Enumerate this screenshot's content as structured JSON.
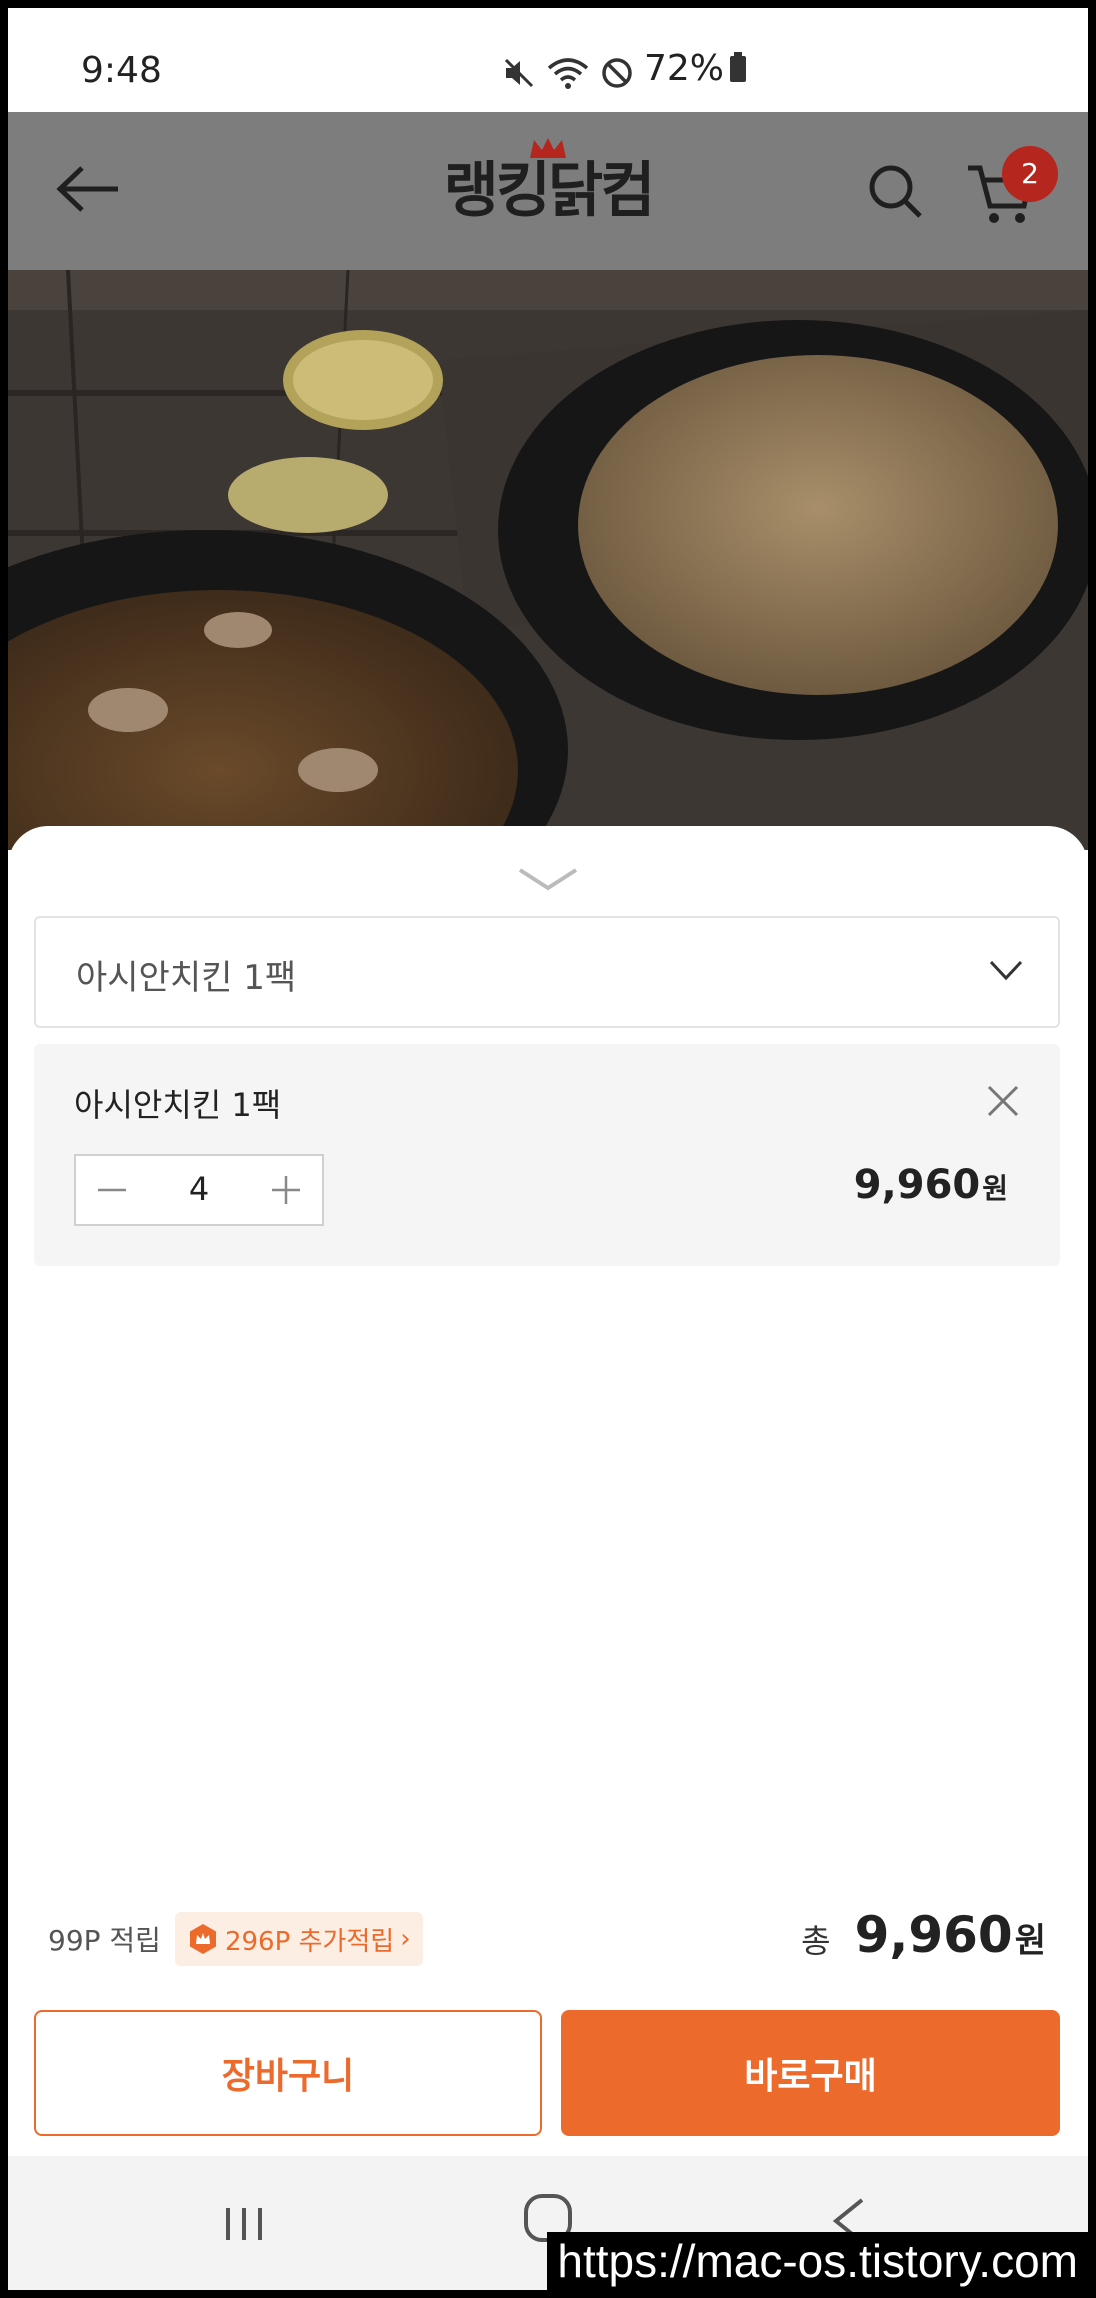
{
  "status_bar": {
    "time": "9:48",
    "battery": "72%",
    "icons": [
      "mute-icon",
      "wifi-icon",
      "do-not-disturb-icon",
      "battery-icon"
    ]
  },
  "app_bar": {
    "logo": "랭킹닭컴",
    "cart_count": "2",
    "icons": [
      "back-arrow-icon",
      "search-icon",
      "cart-icon"
    ]
  },
  "sheet": {
    "selected_option": "아시안치킨 1팩",
    "item": {
      "name": "아시안치킨 1팩",
      "quantity": "4",
      "price": "9,960",
      "price_unit": "원"
    },
    "points": {
      "base": "99P 적립",
      "extra": "296P 추가적립",
      "extra_arrow": "›"
    },
    "total": {
      "label": "총",
      "price": "9,960",
      "unit": "원"
    },
    "buttons": {
      "cart": "장바구니",
      "buy": "바로구매"
    }
  },
  "watermark": "https://mac-os.tistory.com",
  "colors": {
    "accent": "#ec6a2c",
    "badge": "#b5261e",
    "dim_overlay": "#7d7d7d"
  }
}
